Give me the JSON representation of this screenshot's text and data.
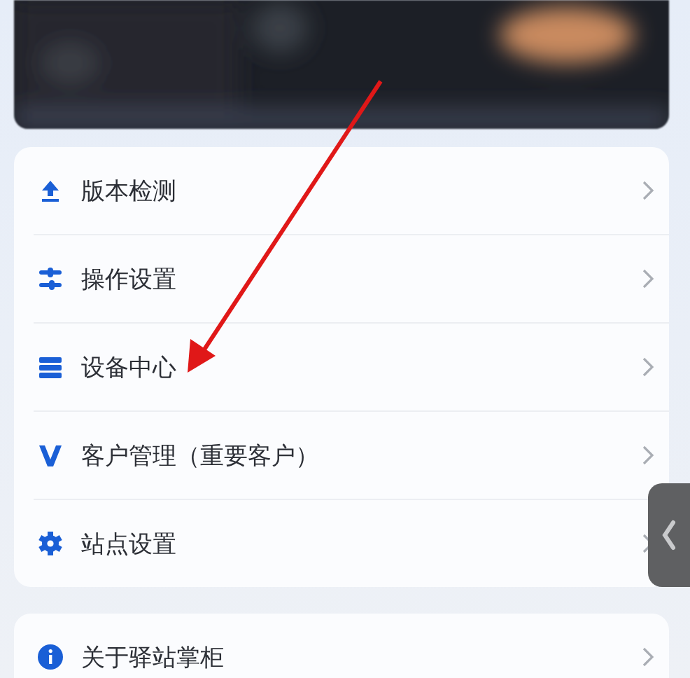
{
  "menu_groups": [
    {
      "items": [
        {
          "label": "版本检测"
        },
        {
          "label": "操作设置"
        },
        {
          "label": "设备中心"
        },
        {
          "label": "客户管理（重要客户）"
        },
        {
          "label": "站点设置"
        }
      ]
    },
    {
      "items": [
        {
          "label": "关于驿站掌柜"
        }
      ]
    }
  ]
}
